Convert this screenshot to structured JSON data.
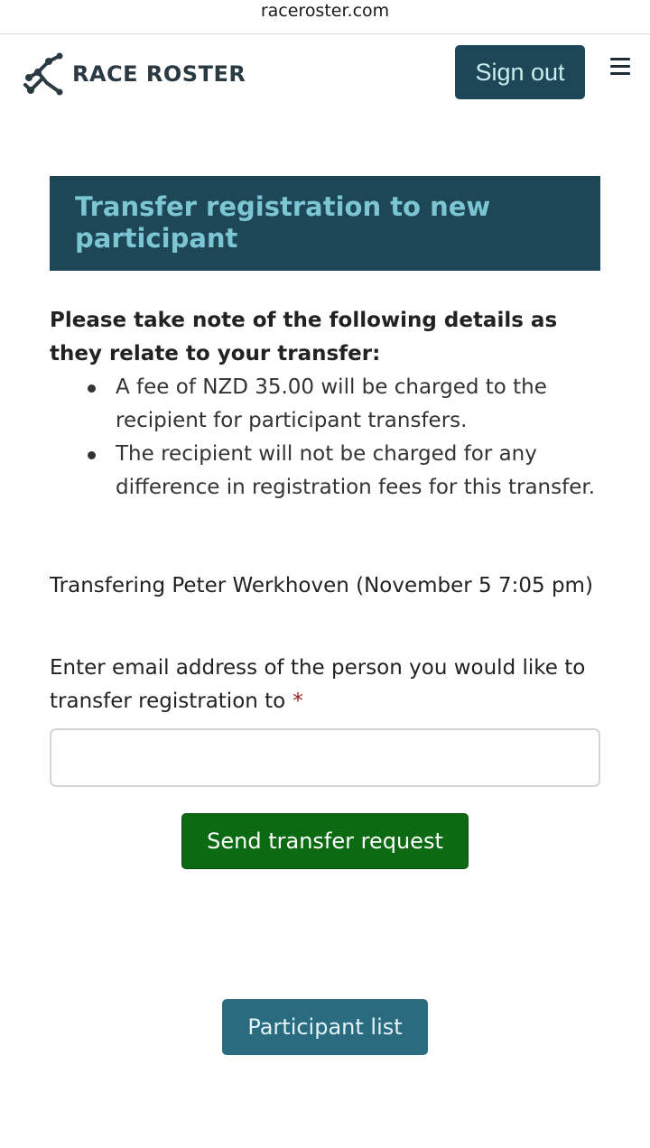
{
  "browser": {
    "url": "raceroster.com"
  },
  "header": {
    "logo_text": "RACE ROSTER",
    "logo_icon": "race-roster-logo-icon",
    "sign_out_label": "Sign out",
    "menu_icon": "hamburger-menu-icon"
  },
  "page": {
    "title": "Transfer registration to new participant",
    "note_heading": "Please take note of the following details as they relate to your transfer:",
    "notes": [
      "A fee of NZD 35.00 will be charged to the recipient for participant transfers.",
      "The recipient will not be charged for any difference in registration fees for this transfer."
    ],
    "transfer_info": "Transfering Peter Werkhoven (November 5 7:05 pm)",
    "email_label": "Enter email address of the person you would like to transfer registration to",
    "required_mark": "*",
    "email_value": "",
    "send_button": "Send transfer request",
    "participant_list_button": "Participant list"
  },
  "colors": {
    "brand_dark": "#1d4656",
    "title_text": "#7bc6d2",
    "send_button": "#0c6b12",
    "participant_button": "#2a6b80",
    "required": "#9b1c1c"
  }
}
